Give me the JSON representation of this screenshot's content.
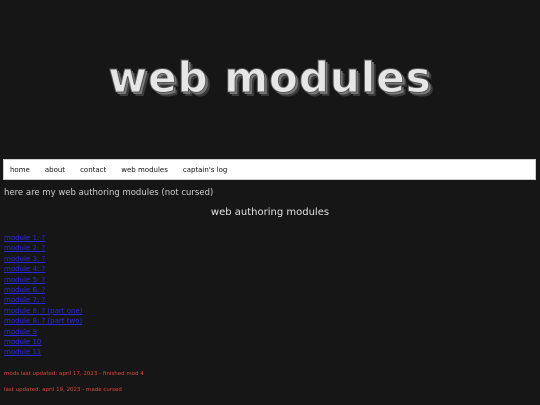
{
  "banner": {
    "title": "web modules"
  },
  "nav": {
    "items": [
      "home",
      "about",
      "contact",
      "web modules",
      "captain's log"
    ]
  },
  "main": {
    "intro": "here are my web authoring modules (not cursed)",
    "section_title": "web authoring modules",
    "modules": [
      "module 1: ?",
      "module 2: ?",
      "module 3: ?",
      "module 4: ?",
      "module 5: ?",
      "module 6: ?",
      "module 7: ?",
      "module 8: ? (part one)",
      "module 8: ? (part two)",
      "module 9",
      "module 10",
      "module 11"
    ],
    "updates": [
      "mods last updated: april 17, 2023 - finished mod 4",
      "last updated: april 19, 2023 - made cursed"
    ]
  }
}
